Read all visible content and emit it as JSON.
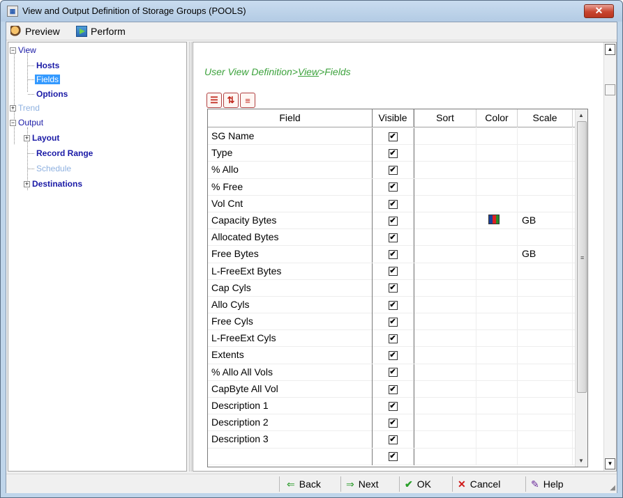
{
  "window": {
    "title": "View and Output Definition of Storage Groups (POOLS)",
    "close_label": "✕",
    "app_icon": "table-icon"
  },
  "toolbar": {
    "preview_label": "Preview",
    "perform_label": "Perform"
  },
  "tree": {
    "view": "View",
    "hosts": "Hosts",
    "fields": "Fields",
    "options": "Options",
    "trend": "Trend",
    "output": "Output",
    "layout": "Layout",
    "record_range": "Record Range",
    "schedule": "Schedule",
    "destinations": "Destinations"
  },
  "breadcrumb": {
    "part1": "User View Definition>",
    "part2": "View",
    "part3": ">Fields"
  },
  "grid": {
    "columns": [
      "Field",
      "Visible",
      "Sort",
      "Color",
      "Scale"
    ],
    "rows": [
      {
        "field": "SG Name",
        "visible": "✔",
        "sort": "",
        "color": "",
        "scale": ""
      },
      {
        "field": "Type",
        "visible": "✔",
        "sort": "",
        "color": "",
        "scale": ""
      },
      {
        "field": "% Allo",
        "visible": "✔",
        "sort": "",
        "color": "",
        "scale": ""
      },
      {
        "field": "% Free",
        "visible": "✔",
        "sort": "",
        "color": "",
        "scale": ""
      },
      {
        "field": "Vol Cnt",
        "visible": "✔",
        "sort": "",
        "color": "",
        "scale": ""
      },
      {
        "field": "Capacity Bytes",
        "visible": "✔",
        "sort": "",
        "color": "chip",
        "scale": "GB"
      },
      {
        "field": "Allocated Bytes",
        "visible": "✔",
        "sort": "",
        "color": "",
        "scale": ""
      },
      {
        "field": "Free Bytes",
        "visible": "✔",
        "sort": "",
        "color": "",
        "scale": "GB"
      },
      {
        "field": "L-FreeExt Bytes",
        "visible": "✔",
        "sort": "",
        "color": "",
        "scale": ""
      },
      {
        "field": "Cap Cyls",
        "visible": "✔",
        "sort": "",
        "color": "",
        "scale": ""
      },
      {
        "field": "Allo Cyls",
        "visible": "✔",
        "sort": "",
        "color": "",
        "scale": ""
      },
      {
        "field": "Free Cyls",
        "visible": "✔",
        "sort": "",
        "color": "",
        "scale": ""
      },
      {
        "field": "L-FreeExt Cyls",
        "visible": "✔",
        "sort": "",
        "color": "",
        "scale": ""
      },
      {
        "field": "Extents",
        "visible": "✔",
        "sort": "",
        "color": "",
        "scale": ""
      },
      {
        "field": "% Allo All Vols",
        "visible": "✔",
        "sort": "",
        "color": "",
        "scale": ""
      },
      {
        "field": "CapByte All Vol",
        "visible": "✔",
        "sort": "",
        "color": "",
        "scale": ""
      },
      {
        "field": "Description 1",
        "visible": "✔",
        "sort": "",
        "color": "",
        "scale": ""
      },
      {
        "field": "Description 2",
        "visible": "✔",
        "sort": "",
        "color": "",
        "scale": ""
      },
      {
        "field": "Description 3",
        "visible": "✔",
        "sort": "",
        "color": "",
        "scale": ""
      },
      {
        "field": "",
        "visible": "✔",
        "sort": "",
        "color": "",
        "scale": ""
      }
    ]
  },
  "bottom": {
    "back_label": "Back",
    "next_label": "Next",
    "ok_label": "OK",
    "cancel_label": "Cancel",
    "help_label": "Help"
  },
  "colors": {
    "breadcrumb_green": "#3ca23c",
    "selection_blue": "#3399ff",
    "tree_link": "#1a1aa6",
    "tree_disabled": "#8fb1e0",
    "close_red": "#c8452f"
  }
}
